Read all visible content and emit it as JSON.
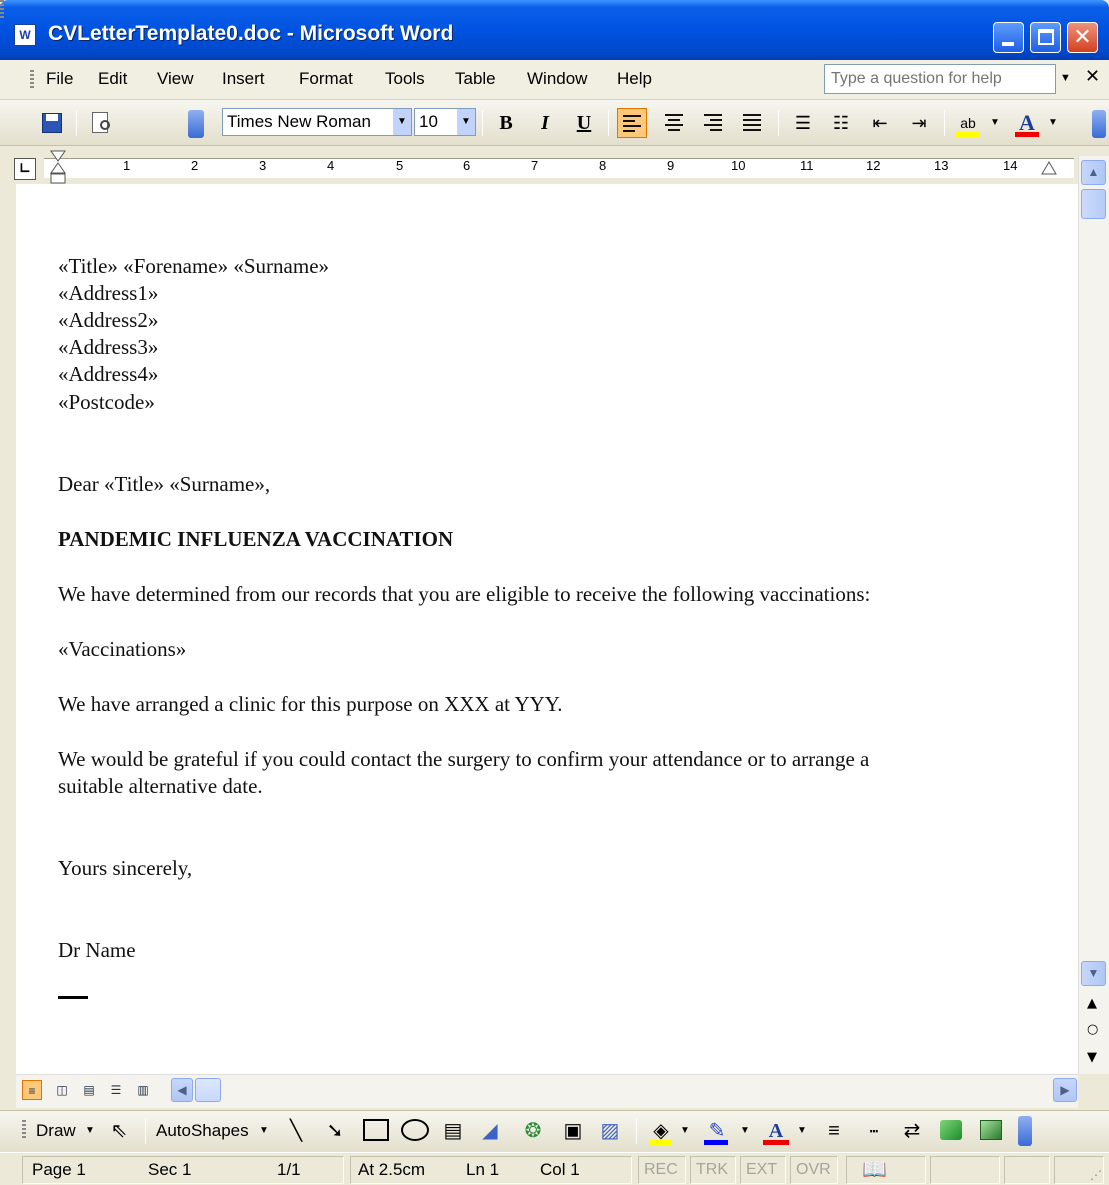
{
  "window": {
    "title": "CVLetterTemplate0.doc - Microsoft Word",
    "app_icon": "word-doc-icon",
    "colors": {
      "titlebar": "#0053e1",
      "close_button": "#d3411f"
    }
  },
  "menubar": {
    "items": [
      "File",
      "Edit",
      "View",
      "Insert",
      "Format",
      "Tools",
      "Table",
      "Window",
      "Help"
    ],
    "help_placeholder": "Type a question for help"
  },
  "toolbar": {
    "font_name": "Times New Roman",
    "font_size": "10",
    "bold_label": "B",
    "italic_label": "I",
    "underline_label": "U",
    "alignment": "left",
    "highlight_color": "#ffff00",
    "font_color": "#e00000"
  },
  "ruler": {
    "numbers": [
      "1",
      "2",
      "3",
      "4",
      "5",
      "6",
      "7",
      "8",
      "9",
      "10",
      "11",
      "12",
      "13",
      "14"
    ]
  },
  "document": {
    "address_lines": [
      "«Title» «Forename» «Surname»",
      "«Address1»",
      "«Address2»",
      "«Address3»",
      "«Address4»",
      "«Postcode»"
    ],
    "salutation": "Dear «Title» «Surname»,",
    "heading": "PANDEMIC INFLUENZA VACCINATION",
    "para1": "We have determined from our records that you are eligible to receive the following vaccinations:",
    "vaccinations_field": "«Vaccinations»",
    "para2": "We have arranged a clinic for this purpose on XXX at YYY.",
    "para3_line1": "We would be grateful if you could contact the surgery to confirm your attendance or to arrange a",
    "para3_line2": "suitable alternative date.",
    "closing": "Yours sincerely,",
    "signature": "Dr Name"
  },
  "drawbar": {
    "draw_label": "Draw",
    "autoshapes_label": "AutoShapes",
    "fill_color": "#ffff00",
    "line_color": "#0000ff",
    "font_color": "#e00000"
  },
  "status": {
    "page": "Page  1",
    "section": "Sec  1",
    "page_of": "1/1",
    "at": "At  2.5cm",
    "line": "Ln  1",
    "col": "Col  1",
    "flags": [
      "REC",
      "TRK",
      "EXT",
      "OVR"
    ]
  }
}
